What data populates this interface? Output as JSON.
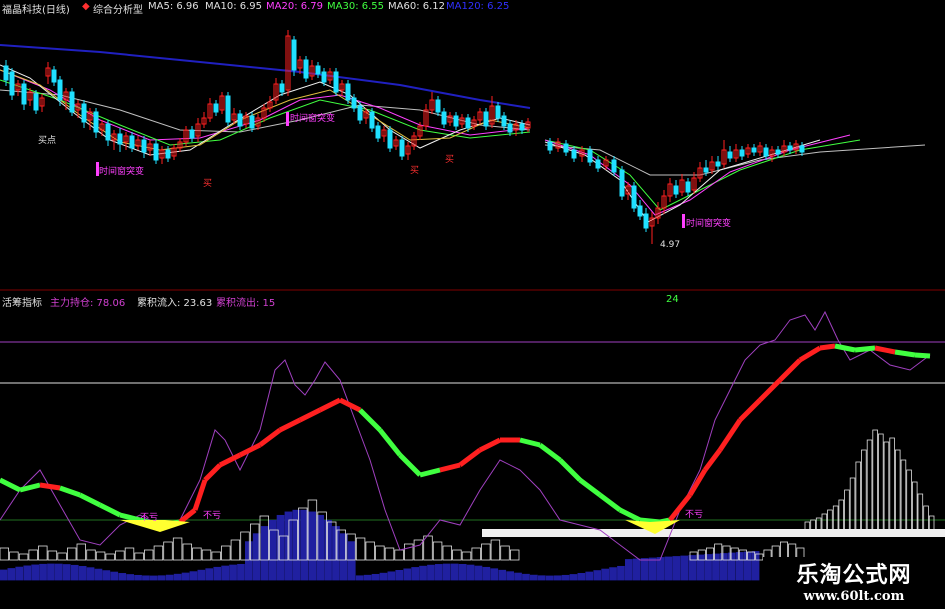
{
  "top_header": {
    "symbol": "福晶科技(日线)",
    "indicator": "综合分析型",
    "ma5": "MA5: 6.96",
    "ma10": "MA10: 6.95",
    "ma20": "MA20: 6.79",
    "ma30": "MA30: 6.55",
    "ma60": "MA60: 6.12",
    "ma120": "MA120: 6.25"
  },
  "bottom_header": {
    "title": "活筹指标",
    "main_hold": "主力持仓: 78.06",
    "inflow": "累积流入: 23.63",
    "outflow": "累积流出: 15",
    "right_value": "24"
  },
  "annotations": {
    "buy_point": "买点",
    "buy": "买",
    "buy_circled": "买",
    "time_window": "时间窗突变",
    "low_price": "4.97",
    "no_loss": "不亏"
  },
  "watermark": {
    "cn": "乐淘公式网",
    "en": "www.60lt.com"
  },
  "colors": {
    "up": "#ff2020",
    "down": "#20e0ff",
    "ma_blue": "#2020c0",
    "line_red": "#ff2020",
    "line_green": "#40ff40",
    "purple": "#a040c0",
    "magenta": "#ff40ff",
    "yellow": "#ffff30",
    "white": "#e0e0e0",
    "volume_blue": "#2020a0"
  },
  "chart_data": [
    {
      "type": "candlestick",
      "title": "福晶科技(日线)",
      "series": [
        {
          "name": "MA5",
          "value": 6.96
        },
        {
          "name": "MA10",
          "value": 6.95
        },
        {
          "name": "MA20",
          "value": 6.79
        },
        {
          "name": "MA30",
          "value": 6.55
        },
        {
          "name": "MA60",
          "value": 6.12
        },
        {
          "name": "MA120",
          "value": 6.25
        }
      ],
      "low_marker": 4.97
    },
    {
      "type": "line",
      "title": "活筹指标",
      "series": [
        {
          "name": "主力持仓",
          "value": 78.06
        },
        {
          "name": "累积流入",
          "value": 23.63
        },
        {
          "name": "累积流出",
          "value": 15
        }
      ]
    }
  ]
}
